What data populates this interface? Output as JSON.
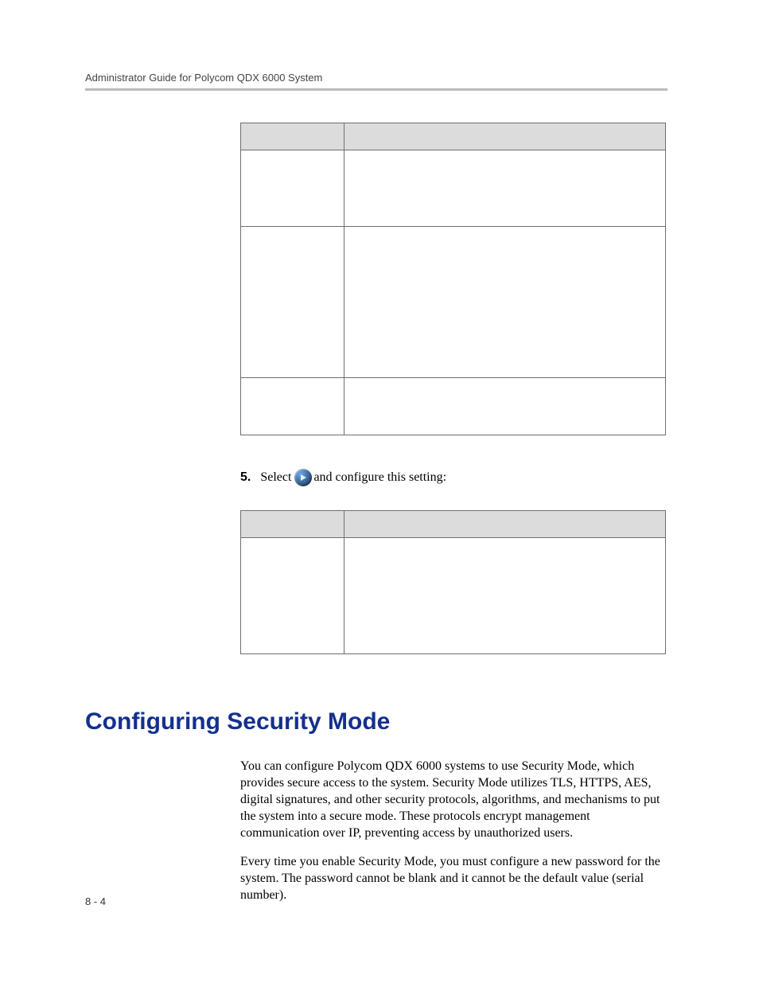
{
  "header": {
    "runningTitle": "Administrator Guide for Polycom QDX 6000 System"
  },
  "step": {
    "number": "5.",
    "before": "Select",
    "after": "and configure this setting:",
    "iconName": "next-arrow-icon"
  },
  "section": {
    "heading": "Configuring Security Mode",
    "para1": "You can configure Polycom QDX 6000 systems to use Security Mode, which provides secure access to the system. Security Mode utilizes TLS, HTTPS, AES, digital signatures, and other security protocols, algorithms, and mechanisms to put the system into a secure mode. These protocols encrypt management communication over IP, preventing access by unauthorized users.",
    "para2": "Every time you enable Security Mode, you must configure a new password for the system. The password cannot be blank and it cannot be the default value (serial number)."
  },
  "footer": {
    "pageNumber": "8 - 4"
  }
}
